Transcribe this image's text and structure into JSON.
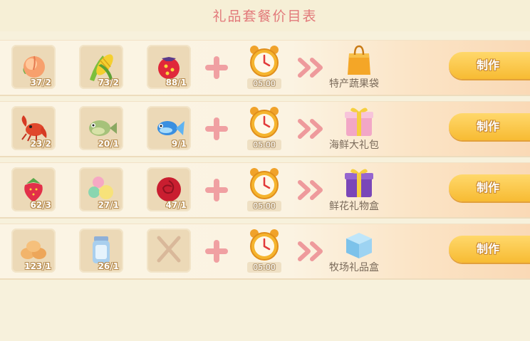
{
  "header": {
    "title": "礼品套餐价目表"
  },
  "recipes": [
    {
      "ingredients": [
        {
          "icon": "peach-icon",
          "count": "37/2"
        },
        {
          "icon": "corn-icon",
          "count": "73/2"
        },
        {
          "icon": "berry-icon",
          "count": "88/1"
        }
      ],
      "time": "05:00",
      "product": {
        "icon": "shopping-bag-icon",
        "name": "特产蔬果袋"
      },
      "button": "制作"
    },
    {
      "ingredients": [
        {
          "icon": "lobster-icon",
          "count": "23/2"
        },
        {
          "icon": "fish-green-icon",
          "count": "20/1"
        },
        {
          "icon": "fish-blue-icon",
          "count": "9/1"
        }
      ],
      "time": "05:00",
      "product": {
        "icon": "gift-box-pink-icon",
        "name": "海鲜大礼包"
      },
      "button": "制作"
    },
    {
      "ingredients": [
        {
          "icon": "strawberry-icon",
          "count": "62/3"
        },
        {
          "icon": "flower-balls-icon",
          "count": "27/1"
        },
        {
          "icon": "rose-icon",
          "count": "47/1"
        }
      ],
      "time": "05:00",
      "product": {
        "icon": "gift-box-purple-icon",
        "name": "鲜花礼物盒"
      },
      "button": "制作"
    },
    {
      "ingredients": [
        {
          "icon": "eggs-icon",
          "count": "123/1"
        },
        {
          "icon": "milk-jar-icon",
          "count": "26/1"
        },
        {
          "icon": "empty-slot-icon",
          "count": ""
        }
      ],
      "time": "05:00",
      "product": {
        "icon": "gift-box-blue-icon",
        "name": "牧场礼品盒"
      },
      "button": "制作"
    }
  ]
}
